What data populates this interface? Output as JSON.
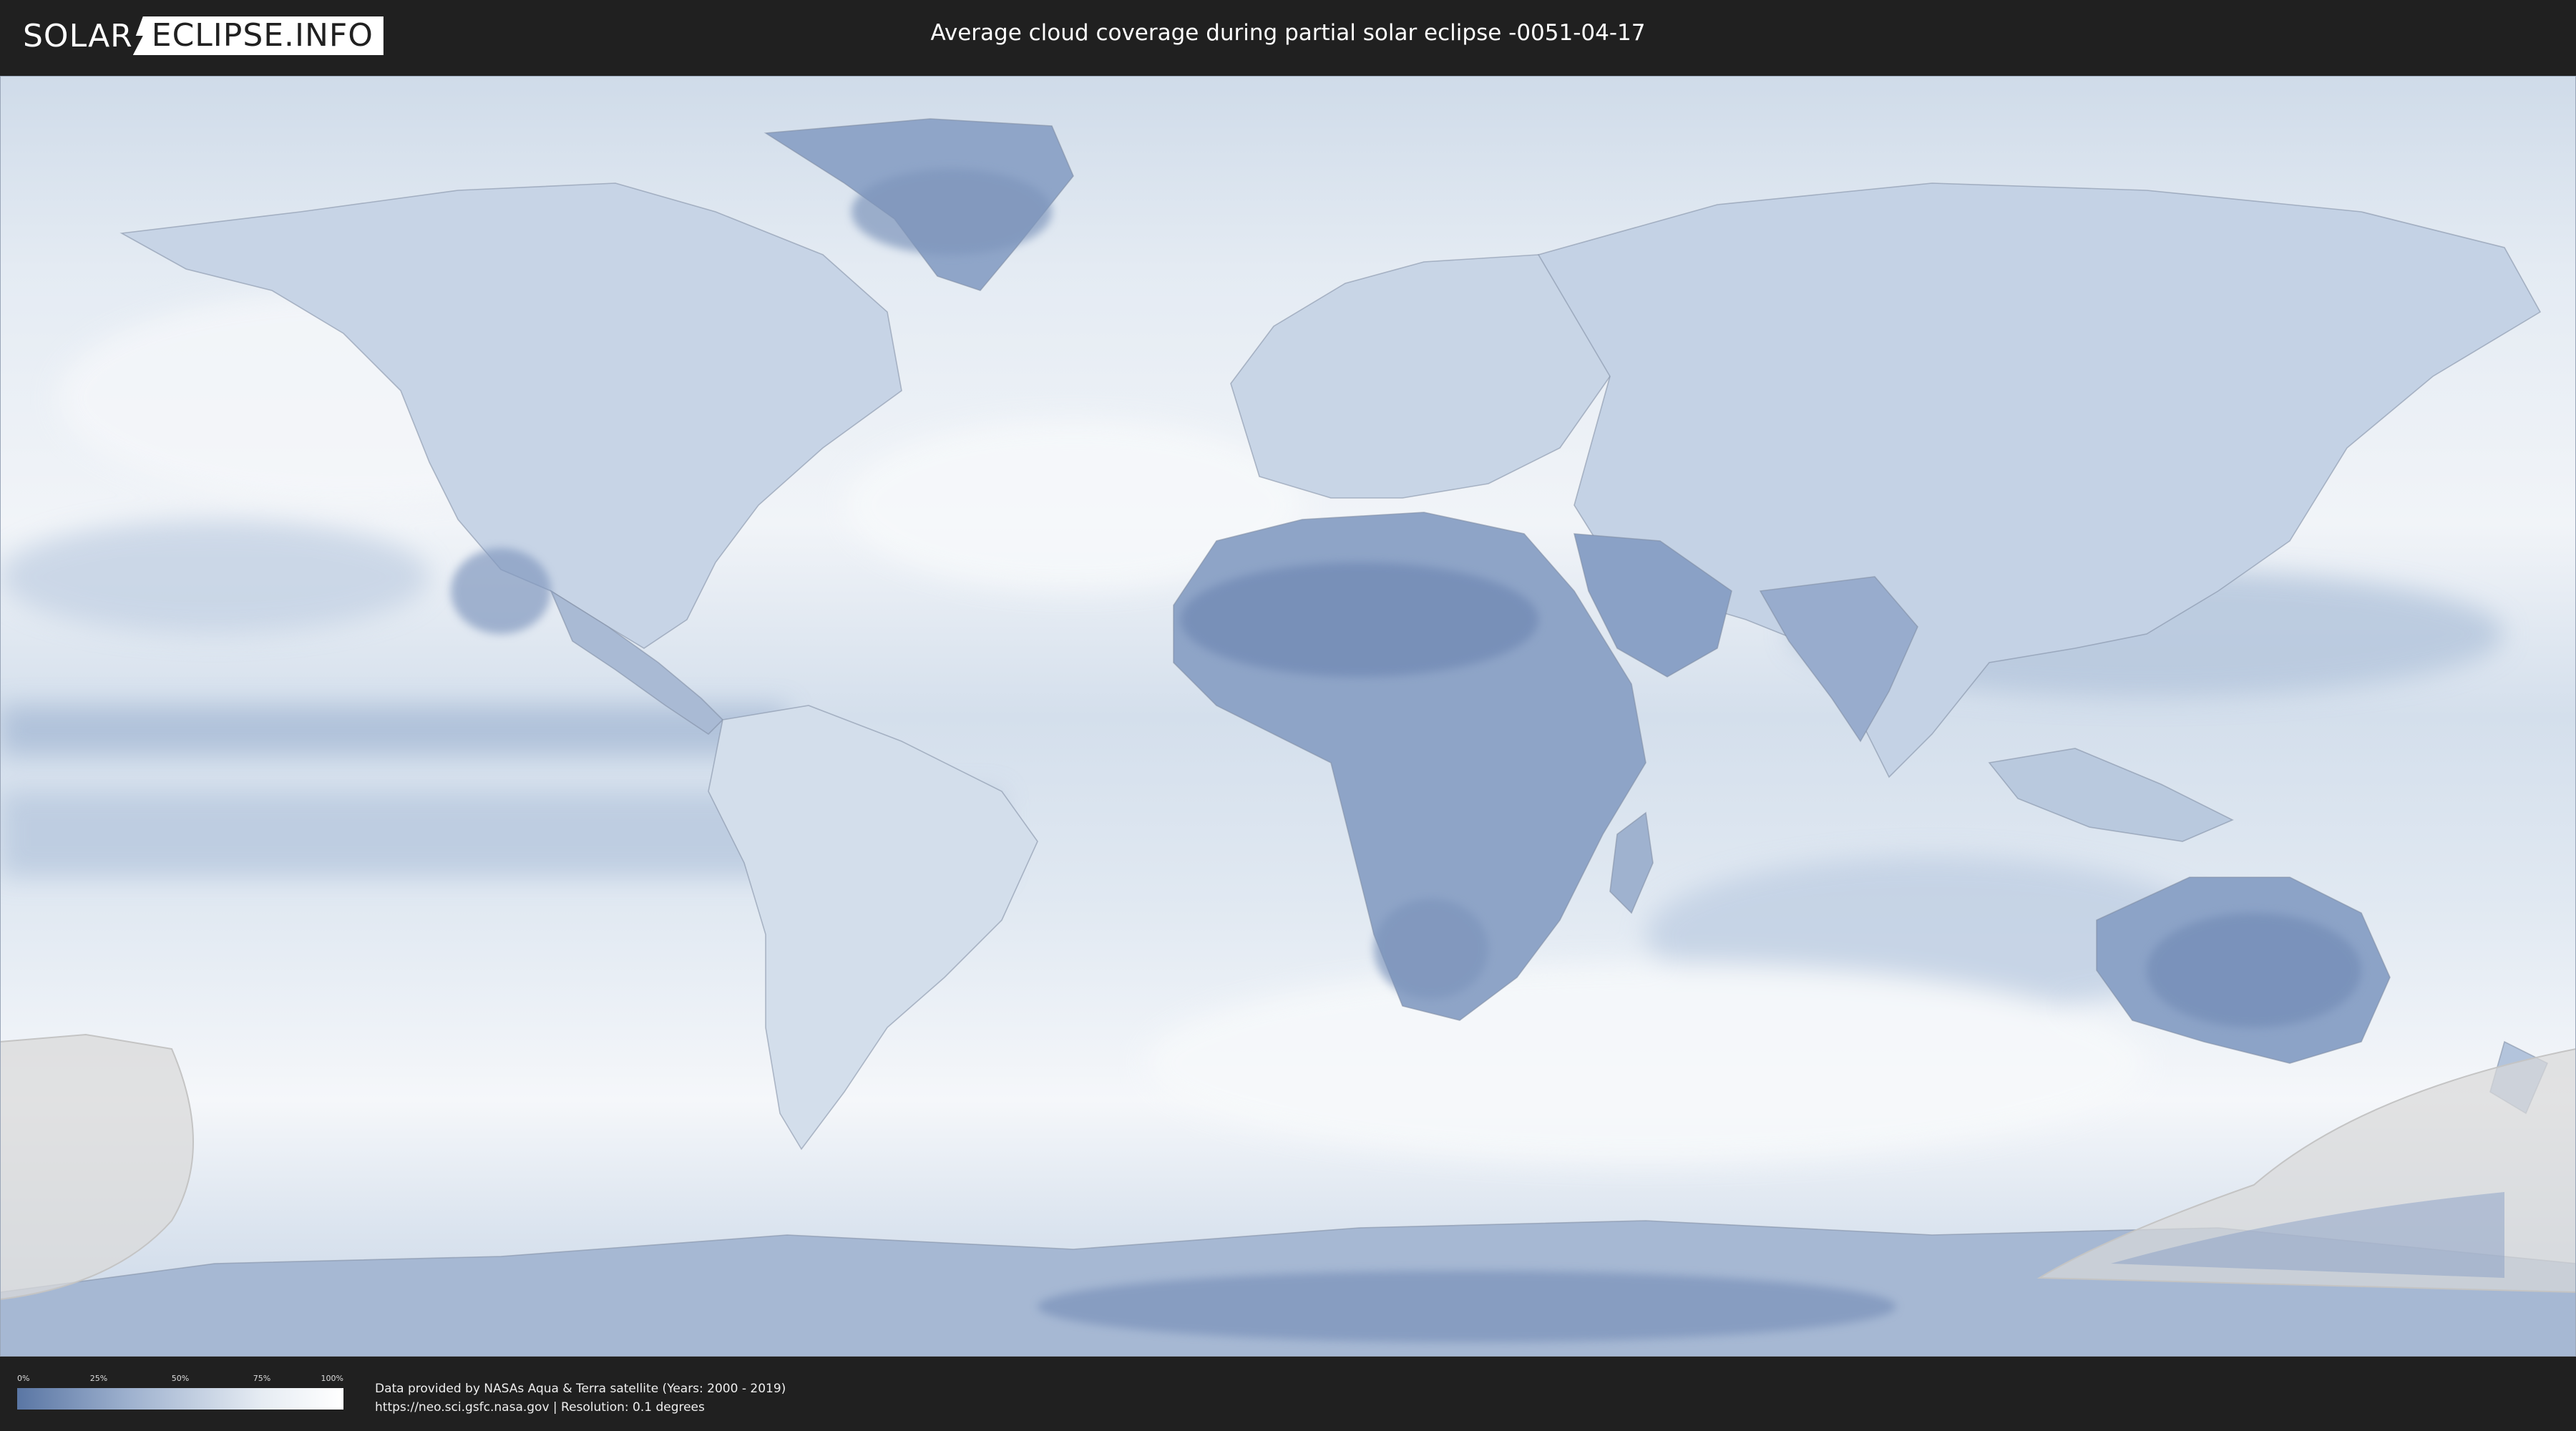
{
  "header": {
    "logo_left": "SOLAR",
    "logo_right": "ECLIPSE.INFO",
    "title": "Average cloud coverage during partial solar eclipse -0051-04-17"
  },
  "legend": {
    "ticks": [
      "0%",
      "25%",
      "50%",
      "75%",
      "100%"
    ],
    "gradient_colors": [
      "#5a76a4",
      "#9fb2cf",
      "#e6ecf3",
      "#ffffff"
    ]
  },
  "footer": {
    "credit_line": "Data provided by NASAs Aqua & Terra satellite (Years: 2000 - 2019)",
    "source_line": "https://neo.sci.gsfc.nasa.gov | Resolution: 0.1 degrees"
  },
  "map": {
    "ocean_color": "#e2e9f2",
    "land_cloudy_color": "#c9d6e6",
    "land_clear_color": "#7b93bb",
    "eclipse_zone_color": "#d8d8d8"
  }
}
